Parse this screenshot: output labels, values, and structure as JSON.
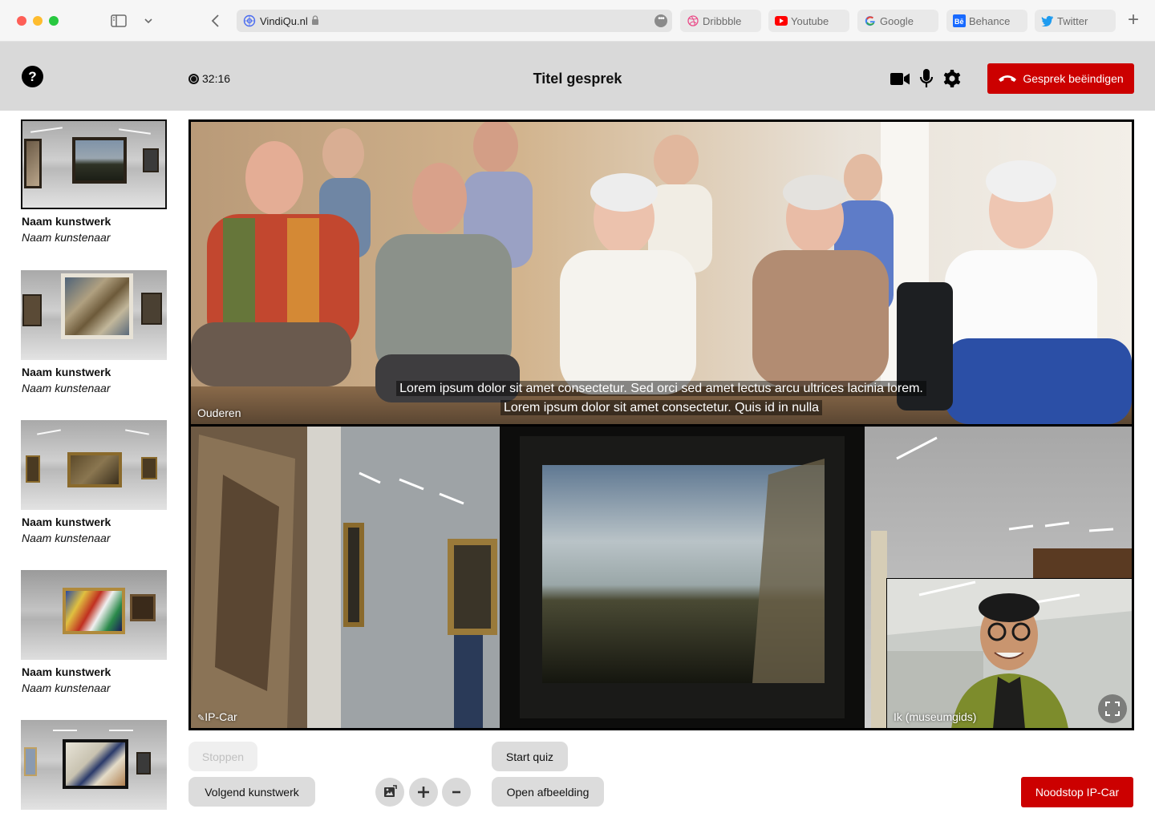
{
  "browser": {
    "address": "VindiQu.nl",
    "bookmarks": [
      {
        "label": "Dribbble",
        "icon": "dribbble-icon"
      },
      {
        "label": "Youtube",
        "icon": "youtube-icon"
      },
      {
        "label": "Google",
        "icon": "google-icon"
      },
      {
        "label": "Behance",
        "icon": "behance-icon"
      },
      {
        "label": "Twitter",
        "icon": "twitter-icon"
      }
    ]
  },
  "header": {
    "help": "?",
    "timer": "32:16",
    "title": "Titel gesprek",
    "end_call": "Gesprek beëindigen",
    "icons": [
      "video-camera-icon",
      "microphone-icon",
      "settings-gear-icon"
    ]
  },
  "artworks": [
    {
      "name": "Naam kunstwerk",
      "artist": "Naam kunstenaar",
      "active": true
    },
    {
      "name": "Naam kunstwerk",
      "artist": "Naam kunstenaar",
      "active": false
    },
    {
      "name": "Naam kunstwerk",
      "artist": "Naam kunstenaar",
      "active": false
    },
    {
      "name": "Naam kunstwerk",
      "artist": "Naam kunstenaar",
      "active": false
    },
    {
      "name": "",
      "artist": "",
      "active": false
    }
  ],
  "video": {
    "top_label": "Ouderen",
    "bottom_label": "IP-Car",
    "self_label": "Ik (museumgids)",
    "subtitles": [
      "Lorem ipsum dolor sit amet consectetur. Sed orci sed amet lectus arcu ultrices lacinia lorem.",
      "Lorem ipsum dolor sit amet consectetur. Quis id in nulla"
    ]
  },
  "controls": {
    "stop": "Stoppen",
    "next_artwork": "Volgend kunstwerk",
    "start_quiz": "Start quiz",
    "open_image": "Open afbeelding",
    "emergency_stop": "Noodstop IP-Car",
    "round_buttons": [
      "image-toggle-icon",
      "zoom-in-icon",
      "zoom-out-icon"
    ]
  },
  "colors": {
    "accent_red": "#cc0000",
    "header_gray": "#d9d9d9",
    "button_gray": "#dcdcdc"
  }
}
